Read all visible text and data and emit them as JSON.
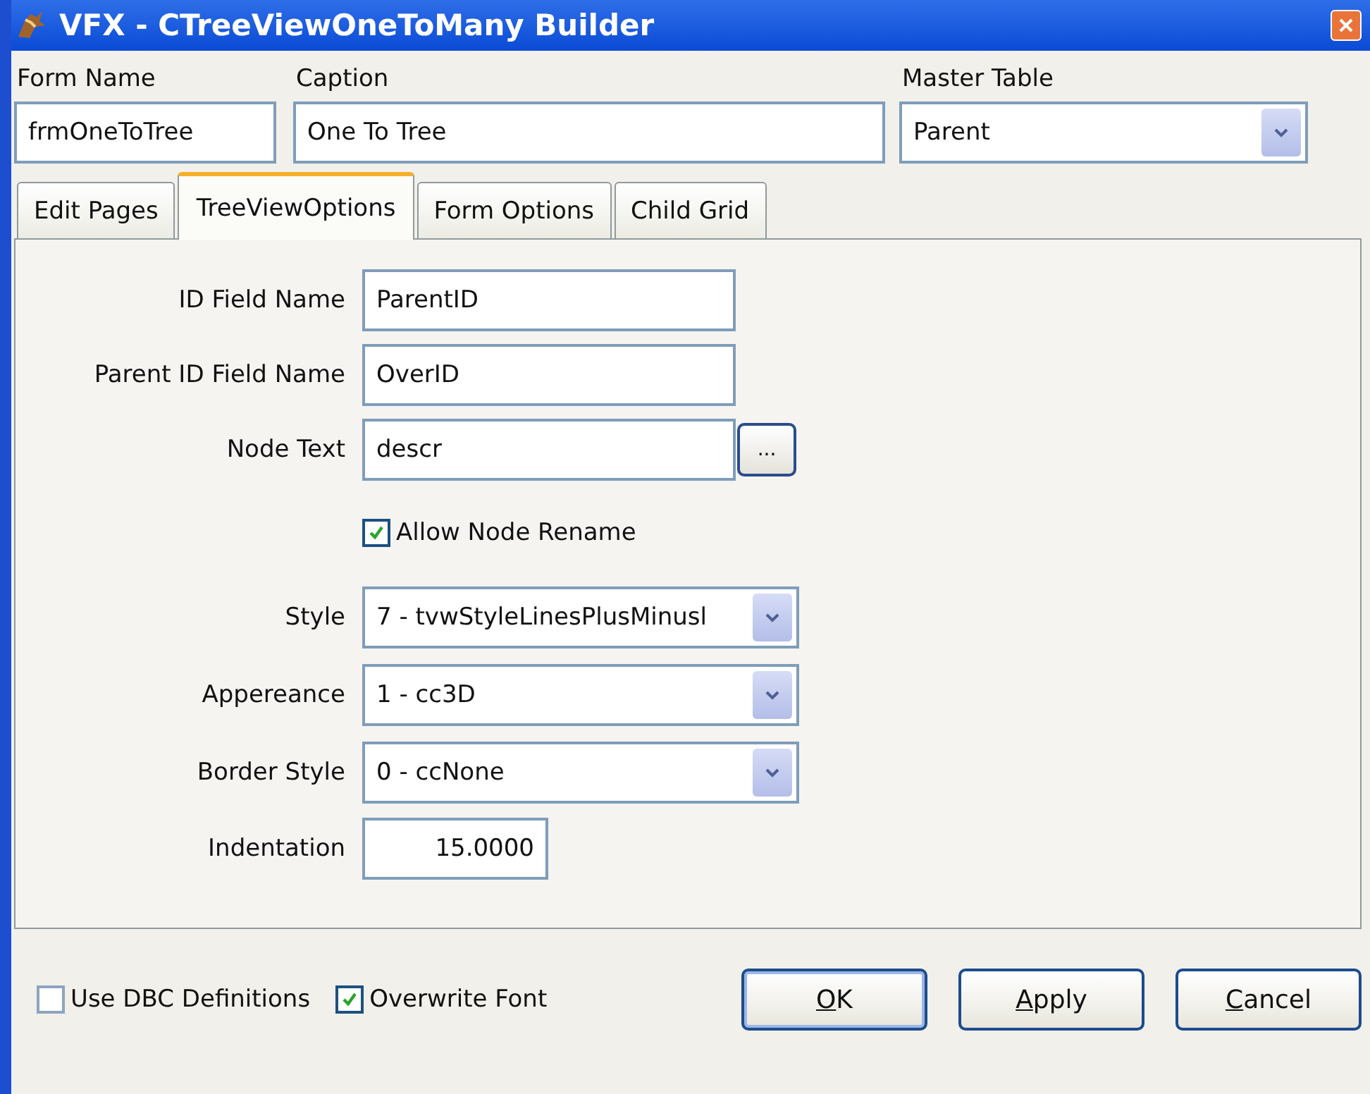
{
  "window": {
    "title": "VFX - CTreeViewOneToMany Builder"
  },
  "header_fields": [
    {
      "label": "Form Name",
      "value": "frmOneToTree",
      "kind": "text"
    },
    {
      "label": "Caption",
      "value": "One To Tree",
      "kind": "text"
    },
    {
      "label": "Master Table",
      "value": "Parent",
      "kind": "select"
    }
  ],
  "tabs": [
    {
      "label": "Edit Pages",
      "selected": false
    },
    {
      "label": "TreeViewOptions",
      "selected": true
    },
    {
      "label": "Form Options",
      "selected": false
    },
    {
      "label": "Child Grid",
      "selected": false
    }
  ],
  "options": [
    {
      "kind": "text",
      "label": "ID Field Name",
      "value": "ParentID"
    },
    {
      "kind": "text",
      "label": "Parent  ID Field Name",
      "value": "OverID"
    },
    {
      "kind": "browse",
      "label": "Node Text",
      "value": "descr",
      "button": "..."
    },
    {
      "kind": "checkbox",
      "label": "Allow Node Rename",
      "checked": true
    },
    {
      "kind": "select",
      "label": "Style",
      "value": "7 - tvwStyleLinesPlusMinusl"
    },
    {
      "kind": "select",
      "label": "Appereance",
      "value": "1 - cc3D"
    },
    {
      "kind": "select",
      "label": "Border Style",
      "value": "0 - ccNone"
    },
    {
      "kind": "number",
      "label": "Indentation",
      "value": "15.0000"
    }
  ],
  "footer_checkboxes": [
    {
      "label": "Use DBC Definitions",
      "checked": false
    },
    {
      "label": "Overwrite Font",
      "checked": true
    }
  ],
  "buttons": [
    {
      "label": "OK",
      "default": true
    },
    {
      "label": "Apply",
      "default": false
    },
    {
      "label": "Cancel",
      "default": false
    }
  ]
}
